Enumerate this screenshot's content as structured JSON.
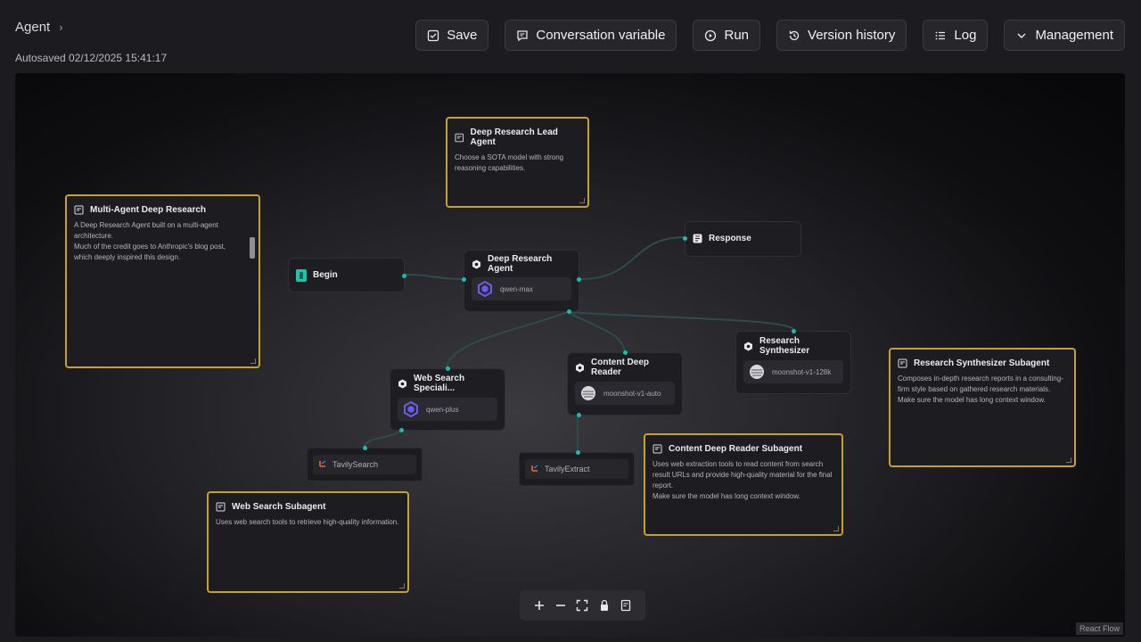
{
  "header": {
    "breadcrumb": "Agent",
    "autosaved": "Autosaved 02/12/2025 15:41:17"
  },
  "toolbar": {
    "save": "Save",
    "conversation_variable": "Conversation variable",
    "run": "Run",
    "version_history": "Version history",
    "log": "Log",
    "management": "Management"
  },
  "nodes": {
    "begin": "Begin",
    "deep_research_agent": {
      "title": "Deep Research Agent",
      "model": "qwen-max"
    },
    "response": "Response",
    "web_search_specialist": {
      "title": "Web Search Speciali...",
      "model": "qwen-plus"
    },
    "content_deep_reader": {
      "title": "Content Deep Reader",
      "model": "moonshot-v1-auto"
    },
    "research_synthesizer": {
      "title": "Research Synthesizer",
      "model": "moonshot-v1-128k"
    },
    "tavily_search": "TavilySearch",
    "tavily_extract": "TavilyExtract"
  },
  "notes": {
    "multi_agent": {
      "title": "Multi-Agent Deep Research",
      "body": "A Deep Research Agent built on a multi-agent architecture.\nMuch of the credit goes to Anthropic's blog post, which deeply inspired this design."
    },
    "lead_agent": {
      "title": "Deep Research Lead Agent",
      "body": "Choose a SOTA model with strong reasoning capabilities."
    },
    "web_search_subagent": {
      "title": "Web Search Subagent",
      "body": "Uses web search tools to retrieve high-quality information."
    },
    "content_reader_subagent": {
      "title": "Content Deep Reader Subagent",
      "body": "Uses web extraction tools to read content from search result URLs and provide high-quality material for the final report.\nMake sure the model has long context window."
    },
    "synthesizer_subagent": {
      "title": "Research Synthesizer Subagent",
      "body": "Composes in-depth research reports in a consulting-firm style based on gathered research materials.\nMake sure the model has long context window."
    }
  },
  "footer": {
    "attribution": "React Flow"
  },
  "colors": {
    "accent_handle": "#1fb8b0",
    "note_border": "#c8a12b",
    "begin_icon": "#22c3a8",
    "model_logo": "#6b5cf0"
  }
}
